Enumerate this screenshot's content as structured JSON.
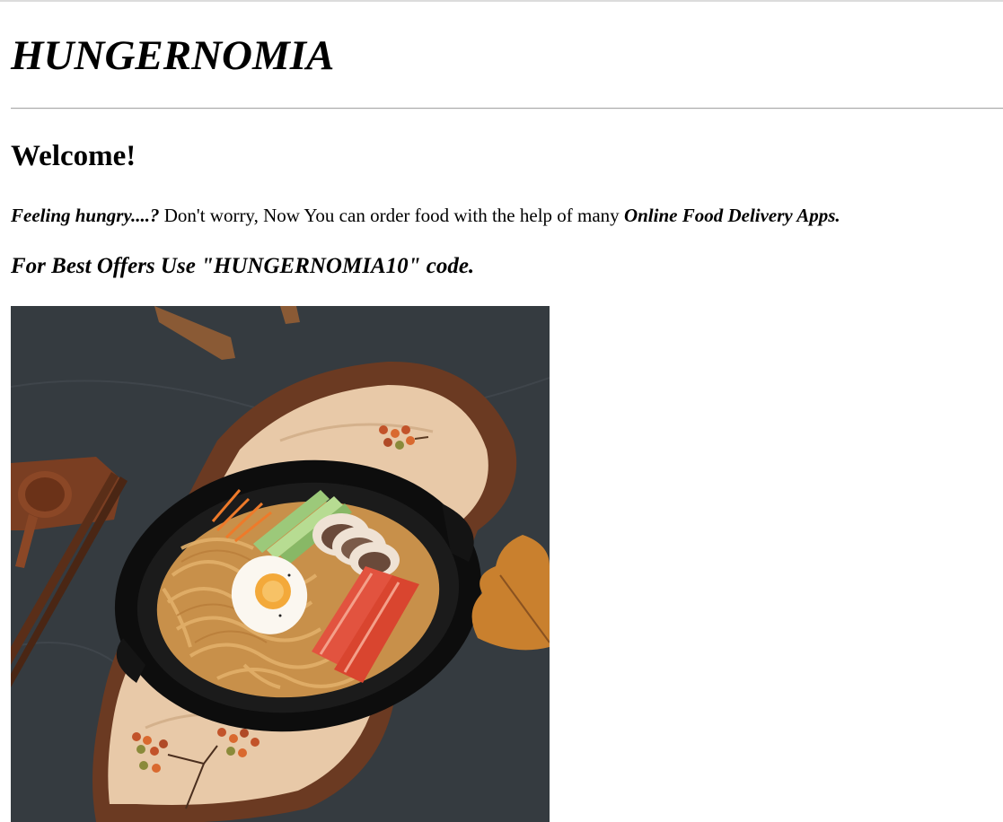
{
  "site": {
    "title": "HUNGERNOMIA"
  },
  "welcome": {
    "heading": "Welcome!"
  },
  "intro": {
    "lead": "Feeling hungry....?",
    "text": " Don't worry, Now You can order food with the help of many ",
    "emphasis": "Online Food Delivery Apps."
  },
  "offer": {
    "text": "For Best Offers Use \"HUNGERNOMIA10\" code."
  },
  "image": {
    "subject": "ramen noodle bowl on wooden board",
    "colors": {
      "background": "#3a3f44",
      "bowl": "#141414",
      "wood": "#e8c9a8",
      "bark": "#6b3a22",
      "noodle": "#d9a55a",
      "crab": "#e2533f",
      "egg_yolk": "#f3a93a",
      "cucumber": "#9cc97a",
      "leaf": "#c9802e"
    }
  }
}
